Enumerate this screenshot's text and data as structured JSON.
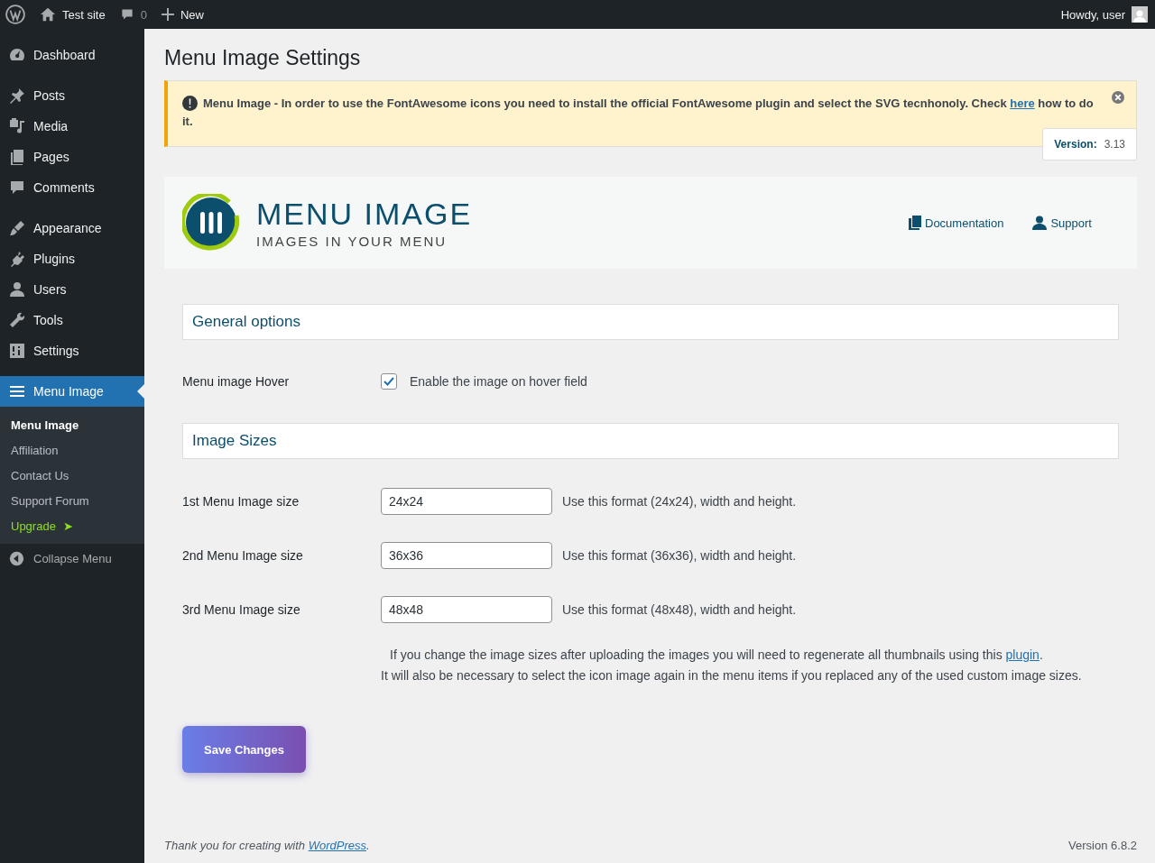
{
  "admin_bar": {
    "site": "Test site",
    "comments": "0",
    "new": "New",
    "greeting": "Howdy, user"
  },
  "sidebar": {
    "items": [
      {
        "label": "Dashboard",
        "selected": false
      },
      {
        "label": "Posts",
        "selected": false
      },
      {
        "label": "Media",
        "selected": false
      },
      {
        "label": "Pages",
        "selected": false
      },
      {
        "label": "Comments",
        "selected": false
      },
      {
        "label": "Appearance",
        "selected": false
      },
      {
        "label": "Plugins",
        "selected": false
      },
      {
        "label": "Users",
        "selected": false
      },
      {
        "label": "Tools",
        "selected": false
      },
      {
        "label": "Settings",
        "selected": false
      },
      {
        "label": "Menu Image",
        "selected": true,
        "children": [
          {
            "label": "Menu Image",
            "selected": true,
            "kind": "link"
          },
          {
            "label": "Affiliation",
            "selected": false,
            "kind": "link"
          },
          {
            "label": "Contact Us",
            "selected": false,
            "kind": "link"
          },
          {
            "label": "Support Forum",
            "selected": false,
            "kind": "link"
          },
          {
            "label": "Upgrade",
            "selected": false,
            "kind": "upgrade",
            "arrow": "➤"
          }
        ]
      }
    ],
    "collapse": "Collapse Menu"
  },
  "page_title": "Menu Image Settings",
  "notice": {
    "before": "Menu Image - In order to use the FontAwesome icons you need to install the official FontAwesome plugin and select the SVG tecnhonoly. Check ",
    "link": "here",
    "after": " how to do it."
  },
  "version": {
    "label": "Version:",
    "value": "3.13"
  },
  "logo": {
    "title": "MENU IMAGE",
    "subtitle": "IMAGES IN YOUR MENU"
  },
  "header_links": [
    "Documentation",
    "Support"
  ],
  "general": {
    "title": "General options",
    "hover": {
      "label": "Menu image Hover",
      "checked": true,
      "text": "Enable the image on hover field"
    }
  },
  "sizes": {
    "title": "Image Sizes",
    "rows": [
      {
        "label": "1st Menu Image size",
        "value": "24x24",
        "hint": "Use this format (24x24), width and height."
      },
      {
        "label": "2nd Menu Image size",
        "value": "36x36",
        "hint": "Use this format (36x36), width and height."
      },
      {
        "label": "3rd Menu Image size",
        "value": "48x48",
        "hint": "Use this format (48x48), width and height."
      }
    ],
    "note": {
      "before": "If you change the image sizes after uploading the images you will need to regenerate all thumbnails using this ",
      "link": "plugin",
      "after": ".",
      "line2": "It will also be necessary to select the icon image again in the menu items if you replaced any of the used custom image sizes."
    }
  },
  "save_button": "Save Changes",
  "footer": {
    "before": "Thank you for creating with ",
    "link": "WordPress",
    "after": ".",
    "version": "Version 6.8.2"
  }
}
